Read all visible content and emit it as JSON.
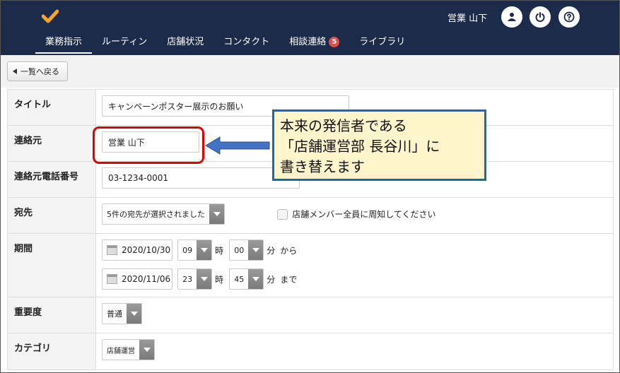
{
  "header": {
    "user_name": "営業 山下",
    "nav": [
      {
        "label": "業務指示"
      },
      {
        "label": "ルーティン"
      },
      {
        "label": "店舗状況"
      },
      {
        "label": "コンタクト"
      },
      {
        "label": "相談連絡",
        "badge": "5"
      },
      {
        "label": "ライブラリ"
      }
    ]
  },
  "back_label": "一覧へ戻る",
  "form": {
    "title_label": "タイトル",
    "title_value": "キャンペーンポスター展示のお願い",
    "sender_label": "連絡元",
    "sender_value": "営業 山下",
    "phone_label": "連絡元電話番号",
    "phone_value": "03-1234-0001",
    "dest_label": "宛先",
    "dest_value": "5件の宛先が選択されました",
    "notify_label": "店舗メンバー全員に周知してください",
    "period_label": "期間",
    "start_date": "2020/10/30",
    "start_hour": "09",
    "start_min": "00",
    "end_date": "2020/11/06",
    "end_hour": "23",
    "end_min": "45",
    "hour_unit": "時",
    "min_unit": "分",
    "from_label": "から",
    "to_label": "まで",
    "priority_label": "重要度",
    "priority_value": "普通",
    "category_label": "カテゴリ",
    "category_value": "店舗運営"
  },
  "callout": "本来の発信者である\n「店舗運営部 長谷川」に\n書き替えます",
  "colors": {
    "header_bg": "#1d2b4a",
    "accent": "#f5a623",
    "callout_border": "#1467c2",
    "highlight": "#e00000"
  }
}
